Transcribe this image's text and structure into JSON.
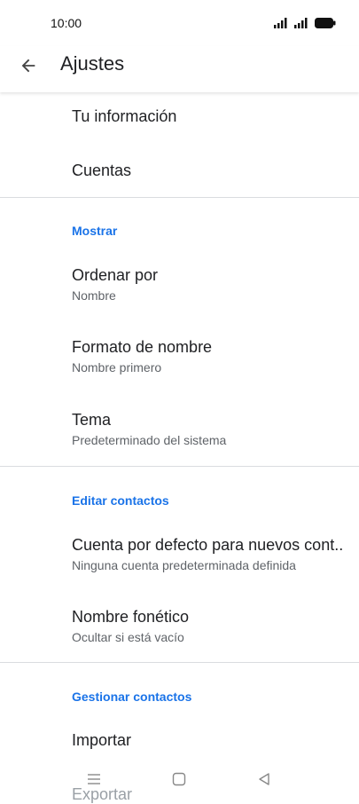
{
  "status": {
    "time": "10:00"
  },
  "app_bar": {
    "title": "Ajustes"
  },
  "items": {
    "tu_informacion": {
      "title": "Tu información"
    },
    "cuentas": {
      "title": "Cuentas"
    },
    "ordenar_por": {
      "title": "Ordenar por",
      "subtitle": "Nombre"
    },
    "formato_nombre": {
      "title": "Formato de nombre",
      "subtitle": "Nombre primero"
    },
    "tema": {
      "title": "Tema",
      "subtitle": "Predeterminado del sistema"
    },
    "cuenta_defecto": {
      "title": "Cuenta por defecto para nuevos cont..",
      "subtitle": "Ninguna cuenta predeterminada definida"
    },
    "nombre_fonetico": {
      "title": "Nombre fonético",
      "subtitle": "Ocultar si está vacío"
    },
    "importar": {
      "title": "Importar"
    },
    "exportar": {
      "title": "Exportar"
    }
  },
  "sections": {
    "mostrar": "Mostrar",
    "editar_contactos": "Editar contactos",
    "gestionar_contactos": "Gestionar contactos"
  },
  "colors": {
    "accent": "#1a73e8",
    "text_primary": "#202124",
    "text_secondary": "#5f6368",
    "divider": "#dadce0"
  },
  "icons": {
    "back": "arrow-left-icon",
    "menu": "menu-icon",
    "home": "square-icon",
    "back_nav": "triangle-back-icon"
  }
}
